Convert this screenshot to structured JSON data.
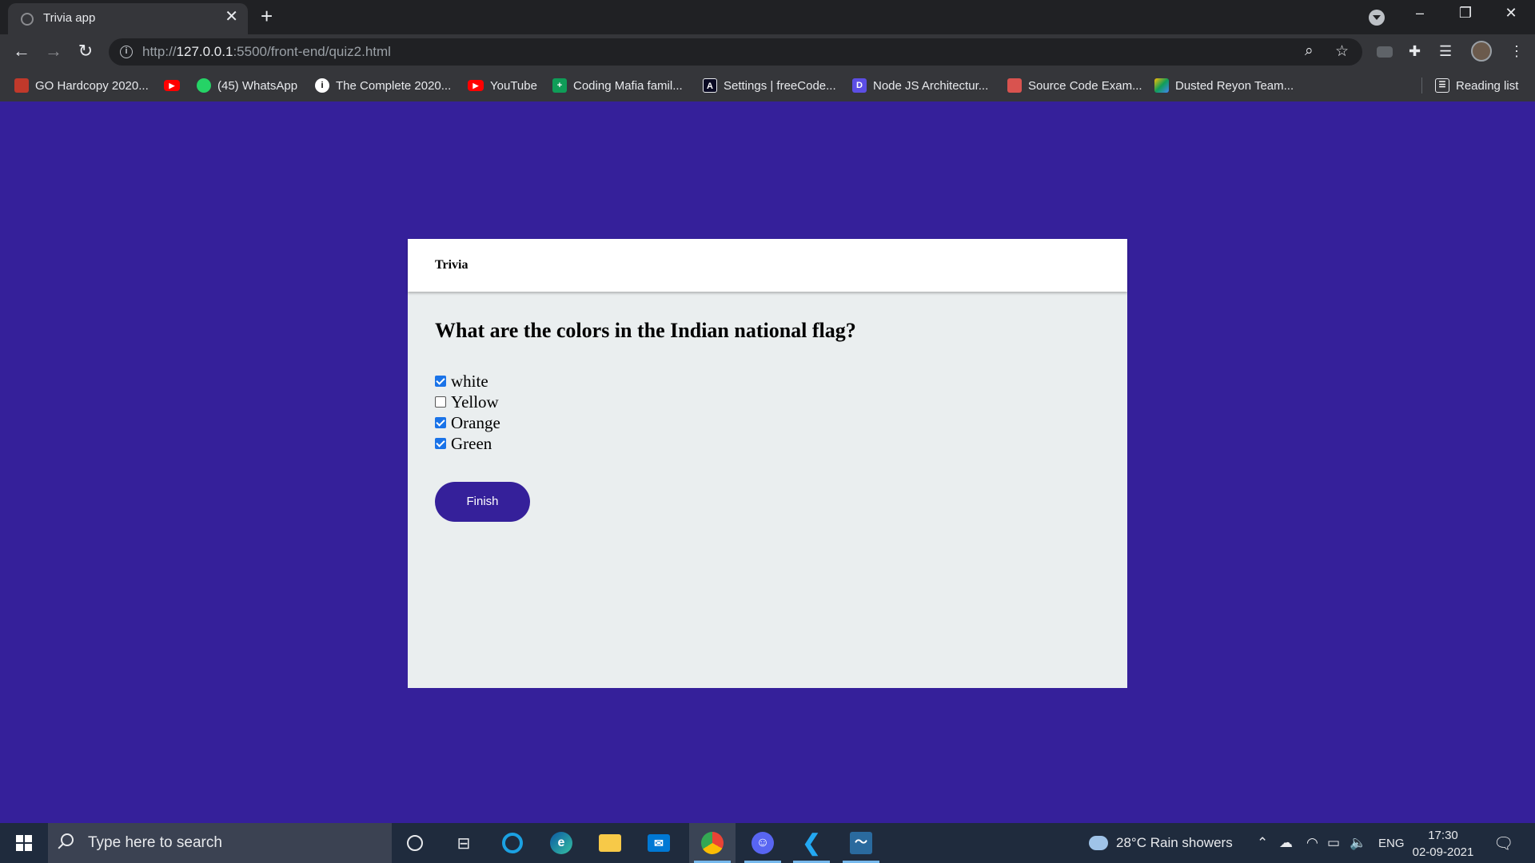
{
  "browser": {
    "tab_title": "Trivia app",
    "tab_close": "✕",
    "new_tab": "+",
    "url_scheme": "http://",
    "url_host": "127.0.0.1",
    "url_rest": ":5500/front-end/quiz2.html",
    "window_controls": {
      "minimize": "–",
      "restore": "❐",
      "close": "✕"
    },
    "nav": {
      "back": "←",
      "forward": "→",
      "reload": "↻"
    },
    "toolbar_icons": [
      "zoom-icon",
      "star-icon",
      "extension-icon",
      "puzzle-icon",
      "media-icon",
      "profile-avatar",
      "menu-icon"
    ]
  },
  "bookmarks": {
    "items": [
      {
        "label": "GO Hardcopy 2020...",
        "icon": "go-icon",
        "color": "#c0392b"
      },
      {
        "label": "",
        "icon": "youtube-icon",
        "color": "#ff0000"
      },
      {
        "label": "(45) WhatsApp",
        "icon": "whatsapp-icon",
        "color": "#25d366"
      },
      {
        "label": "The Complete 2020...",
        "icon": "udemy-icon",
        "color": "#ffffff"
      },
      {
        "label": "YouTube",
        "icon": "youtube-icon",
        "color": "#ff0000"
      },
      {
        "label": "Coding Mafia famil...",
        "icon": "sheets-icon",
        "color": "#0f9d58"
      },
      {
        "label": "Settings | freeCode...",
        "icon": "freecodecamp-icon",
        "color": "#0a0a23"
      },
      {
        "label": "Node JS Architectur...",
        "icon": "node-icon",
        "color": "#5c4ee5"
      },
      {
        "label": "Source Code Exam...",
        "icon": "source-icon",
        "color": "#d9534f"
      },
      {
        "label": "Dusted Reyon Team...",
        "icon": "drive-icon",
        "color": "#fbbc04"
      }
    ],
    "reading_list": "Reading list"
  },
  "quiz": {
    "brand": "Trivia",
    "question": "What are the colors in the Indian national flag?",
    "options": [
      {
        "label": "white",
        "checked": true
      },
      {
        "label": "Yellow",
        "checked": false
      },
      {
        "label": "Orange",
        "checked": true
      },
      {
        "label": "Green",
        "checked": true
      }
    ],
    "finish_label": "Finish"
  },
  "taskbar": {
    "search_placeholder": "Type here to search",
    "apps": [
      "cortana-icon",
      "task-view-icon",
      "cortana-ring-icon",
      "edge-icon",
      "file-explorer-icon",
      "mail-icon",
      "chrome-icon",
      "discord-icon",
      "vscode-icon",
      "mysql-workbench-icon"
    ],
    "weather": "28°C  Rain showers",
    "language": "ENG",
    "time": "17:30",
    "date": "02-09-2021"
  },
  "colors": {
    "page_background": "#35209a",
    "button_background": "#35209a",
    "card_background": "#eaeeef",
    "checkbox_checked": "#1a73e8"
  }
}
